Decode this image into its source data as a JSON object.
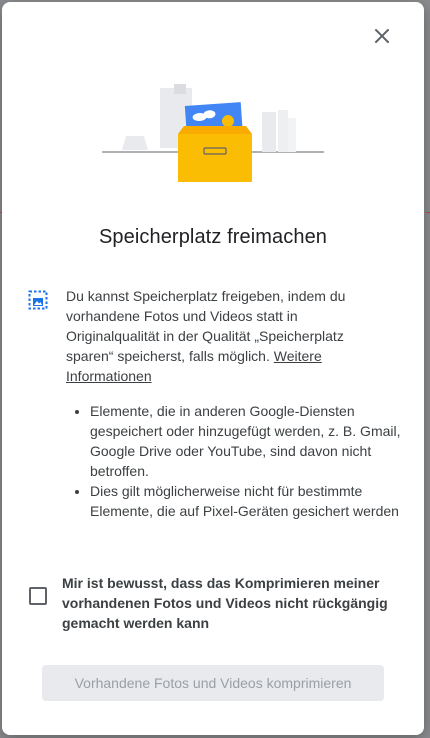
{
  "dialog": {
    "title": "Speicherplatz freimachen",
    "info_text": "Du kannst Speicherplatz freigeben, indem du vorhandene Fotos und Videos statt in Originalqualität in der Qualität „Speicherplatz sparen“ speicherst, falls möglich. ",
    "learn_more_link": "Weitere Informationen",
    "bullets": [
      "Elemente, die in anderen Google-Diensten gespeichert oder hinzugefügt werden, z. B. Gmail, Google Drive oder YouTube, sind davon nicht betroffen.",
      "Dies gilt möglicherweise nicht für bestimmte Elemente, die auf Pixel-Geräten gesichert werden"
    ],
    "checkbox_label": "Mir ist bewusst, dass das Komprimieren meiner vorhandenen Fotos und Videos nicht rückgängig gemacht werden kann",
    "checkbox_checked": false,
    "compress_button": "Vorhandene Fotos und Videos komprimieren",
    "compress_button_enabled": false
  },
  "icons": {
    "close": "close-icon",
    "info": "photo-compress-icon",
    "illustration": "storage-box-illustration"
  },
  "colors": {
    "accent_blue": "#1a73e8",
    "box_yellow": "#fbbc04",
    "disabled_button_bg": "#e8eaed",
    "disabled_button_text": "#9aa0a6"
  }
}
